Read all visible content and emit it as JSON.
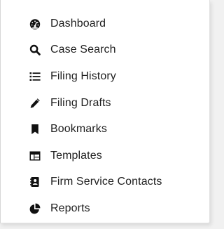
{
  "menu": {
    "items": [
      {
        "label": "Dashboard",
        "icon": "dashboard-icon"
      },
      {
        "label": "Case Search",
        "icon": "search-icon"
      },
      {
        "label": "Filing History",
        "icon": "list-icon"
      },
      {
        "label": "Filing Drafts",
        "icon": "pencil-icon"
      },
      {
        "label": "Bookmarks",
        "icon": "bookmark-icon"
      },
      {
        "label": "Templates",
        "icon": "table-icon"
      },
      {
        "label": "Firm Service Contacts",
        "icon": "address-book-icon"
      },
      {
        "label": "Reports",
        "icon": "chart-pie-icon"
      }
    ]
  },
  "colors": {
    "icon": "#111111",
    "text": "#1f1f1f",
    "background": "#ffffff"
  }
}
